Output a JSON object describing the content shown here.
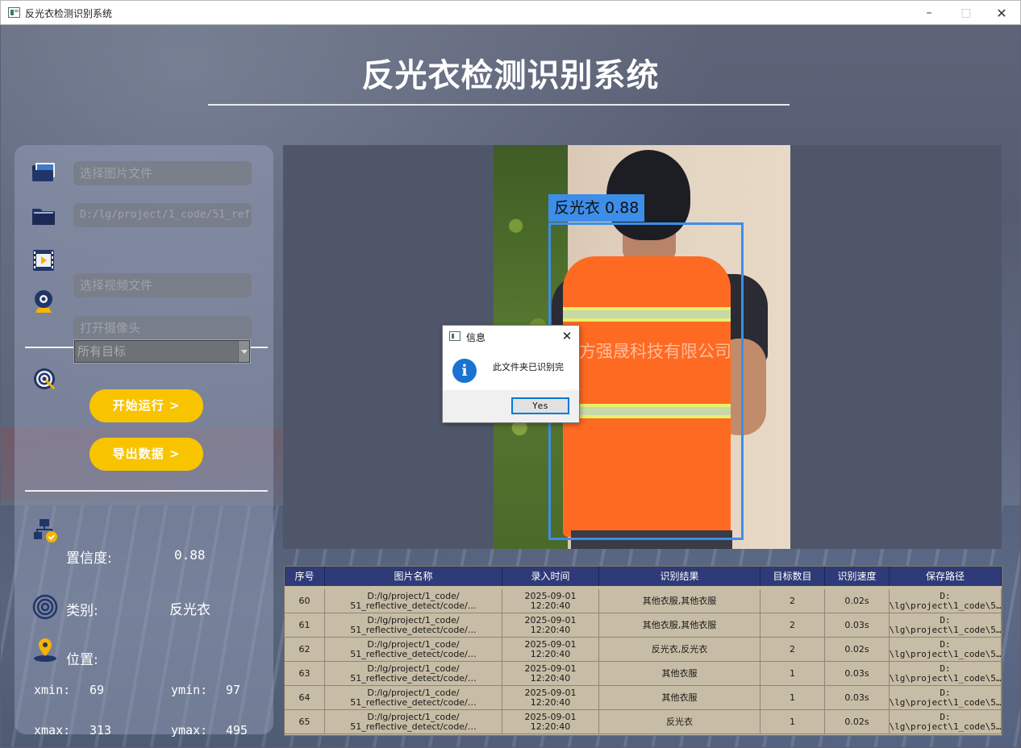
{
  "window": {
    "title": "反光衣检测识别系统"
  },
  "header": {
    "title": "反光衣检测识别系统"
  },
  "left_panel": {
    "image_file_placeholder": "选择图片文件",
    "folder_path_value": "D:/lg/project/1_code/51_ref",
    "video_file_placeholder": "选择视频文件",
    "camera_placeholder": "打开摄像头",
    "target_select_value": "所有目标",
    "start_button": "开始运行 >",
    "export_button": "导出数据 >",
    "confidence_label": "置信度:",
    "confidence_value": "0.88",
    "class_label": "类别:",
    "class_value": "反光衣",
    "position_label": "位置:",
    "xmin_label": "xmin:",
    "xmin_value": "69",
    "ymin_label": "ymin:",
    "ymin_value": "97",
    "xmax_label": "xmax:",
    "xmax_value": "313",
    "ymax_label": "ymax:",
    "ymax_value": "495"
  },
  "image_view": {
    "detection_label": "反光衣 0.88",
    "watermark": "方强晟科技有限公司",
    "box_color": "#3d8ee8"
  },
  "table": {
    "headers": [
      "序号",
      "图片名称",
      "录入时间",
      "识别结果",
      "目标数目",
      "识别速度",
      "保存路径"
    ],
    "rows": [
      {
        "index": "60",
        "name": "D:/lg/project/1_code/\n51_reflective_detect/code/…",
        "time": "2025-09-01\n12:20:40",
        "result": "其他衣服,其他衣服",
        "count": "2",
        "speed": "0.02s",
        "path": "D:\n\\lg\\project\\1_code\\5…"
      },
      {
        "index": "61",
        "name": "D:/lg/project/1_code/\n51_reflective_detect/code/…",
        "time": "2025-09-01\n12:20:40",
        "result": "其他衣服,其他衣服",
        "count": "2",
        "speed": "0.03s",
        "path": "D:\n\\lg\\project\\1_code\\5…"
      },
      {
        "index": "62",
        "name": "D:/lg/project/1_code/\n51_reflective_detect/code/…",
        "time": "2025-09-01\n12:20:40",
        "result": "反光衣,反光衣",
        "count": "2",
        "speed": "0.02s",
        "path": "D:\n\\lg\\project\\1_code\\5…"
      },
      {
        "index": "63",
        "name": "D:/lg/project/1_code/\n51_reflective_detect/code/…",
        "time": "2025-09-01\n12:20:40",
        "result": "其他衣服",
        "count": "1",
        "speed": "0.03s",
        "path": "D:\n\\lg\\project\\1_code\\5…"
      },
      {
        "index": "64",
        "name": "D:/lg/project/1_code/\n51_reflective_detect/code/…",
        "time": "2025-09-01\n12:20:40",
        "result": "其他衣服",
        "count": "1",
        "speed": "0.03s",
        "path": "D:\n\\lg\\project\\1_code\\5…"
      },
      {
        "index": "65",
        "name": "D:/lg/project/1_code/\n51_reflective_detect/code/…",
        "time": "2025-09-01\n12:20:40",
        "result": "反光衣",
        "count": "1",
        "speed": "0.02s",
        "path": "D:\n\\lg\\project\\1_code\\5…"
      }
    ]
  },
  "dialog": {
    "title": "信息",
    "message": "此文件夹已识别完",
    "button": "Yes"
  },
  "colors": {
    "accent_button": "#f8c400",
    "table_header": "#2e3b78",
    "table_body": "#c7bca5",
    "info_icon": "#1a73d0"
  },
  "icons": {
    "image_file": "image-folder-icon",
    "folder": "folder-icon",
    "video": "video-file-icon",
    "camera": "webcam-icon",
    "target": "target-icon",
    "confidence": "network-check-icon",
    "class": "concentric-circle-icon",
    "position": "location-pin-icon"
  }
}
